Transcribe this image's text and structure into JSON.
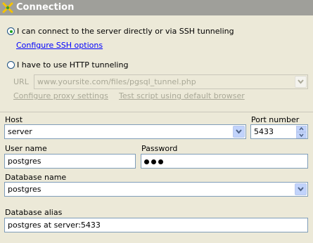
{
  "panel": {
    "title": "Connection",
    "icon": "connection-icon"
  },
  "connection_mode": {
    "direct_label": "I can connect to the server directly or via SSH tunneling",
    "ssh_link": "Configure SSH options",
    "http_label": "I have to use HTTP tunneling",
    "url_label": "URL",
    "url_value": "www.yoursite.com/files/pgsql_tunnel.php",
    "proxy_link": "Configure proxy settings",
    "test_link": "Test script using default browser",
    "selected": "direct"
  },
  "fields": {
    "host_label": "Host",
    "host_value": "server",
    "port_label": "Port number",
    "port_value": "5433",
    "user_label": "User name",
    "user_value": "postgres",
    "password_label": "Password",
    "password_length": 3,
    "dbname_label": "Database name",
    "dbname_value": "postgres",
    "alias_label": "Database alias",
    "alias_value": "postgres at server:5433"
  },
  "colors": {
    "titlebar": "#9f9f9a",
    "background": "#ece9d8",
    "link": "#0000ff",
    "disabled_text": "#a9a897",
    "input_border": "#7f9db9",
    "combo_button": "#c1d3fb",
    "radio_selected": "#21a121"
  }
}
